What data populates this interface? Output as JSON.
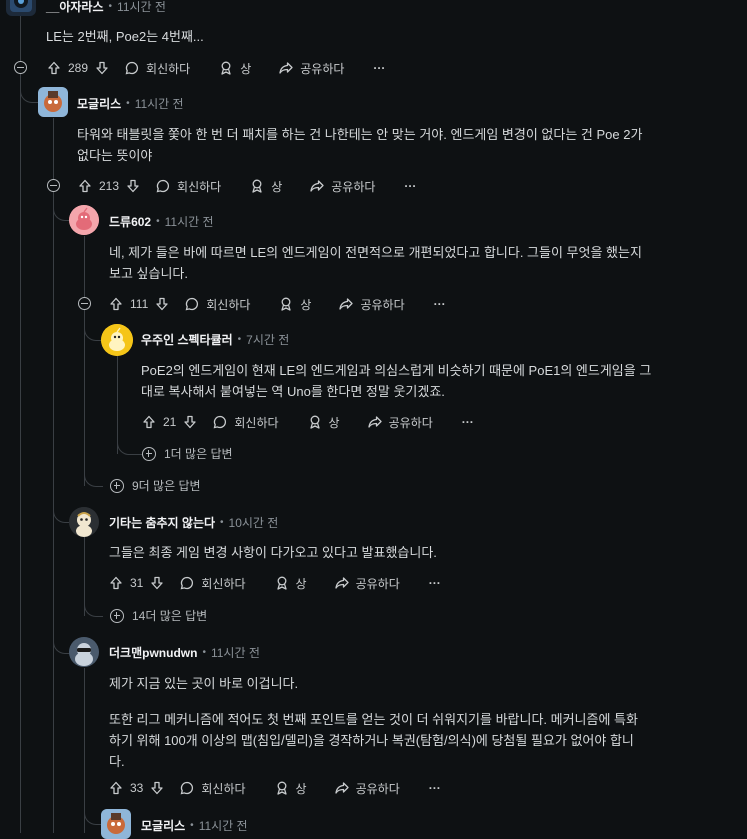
{
  "comments": [
    {
      "user": "__아자라스",
      "time": "11시간 전",
      "lines": [
        "LE는 2번째, Poe2는 4번째..."
      ],
      "votes": "289"
    },
    {
      "user": "모글리스",
      "time": "11시간 전",
      "lines": [
        "타워와 태블릿을 쫓아 한 번 더 패치를 하는 건 나한테는 안 맞는 거야. 엔드게임 변경이 없다는 건 Poe 2가",
        "없다는 뜻이야"
      ],
      "votes": "213"
    },
    {
      "user": "드류602",
      "time": "11시간 전",
      "lines": [
        "네, 제가 들은 바에 따르면 LE의 엔드게임이 전면적으로 개편되었다고 합니다. 그들이 무엇을 했는지",
        "보고 싶습니다."
      ],
      "votes": "111"
    },
    {
      "user": "우주인 스펙타큘러",
      "time": "7시간 전",
      "lines": [
        "PoE2의 엔드게임이 현재 LE의 엔드게임과 의심스럽게 비슷하기 때문에 PoE1의 엔드게임을 그",
        "대로 복사해서 붙여넣는 역 Uno를 한다면 정말 웃기겠죠."
      ],
      "votes": "21"
    },
    {
      "user": "기타는 춤추지 않는다",
      "time": "10시간 전",
      "lines": [
        "그들은 최종 게임 변경 사항이 다가오고 있다고 발표했습니다."
      ],
      "votes": "31"
    },
    {
      "user": "더크맨pwnudwn",
      "time": "11시간 전",
      "lines": [
        "제가 지금 있는 곳이 바로 이겁니다.",
        "",
        "또한 리그 메커니즘에 적어도 첫 번째 포인트를 얻는 것이 더 쉬워지기를 바랍니다. 메커니즘에 특화",
        "하기 위해 100개 이상의 맵(침입/델리)을 경작하거나 복권(탐험/의식)에 당첨될 필요가 없어야 합니",
        "다."
      ],
      "votes": "33"
    },
    {
      "user": "모글리스",
      "time": "11시간 전"
    }
  ],
  "actions": {
    "reply": "회신하다",
    "award": "상",
    "share": "공유하다",
    "more": "···"
  },
  "more_replies": [
    "1더 많은 답변",
    "9더 많은 답변",
    "14더 많은 답변"
  ],
  "colors": {
    "background": "#0e1113",
    "text": "#d7dadc",
    "muted": "#8b9298",
    "line": "#3a3f44"
  }
}
